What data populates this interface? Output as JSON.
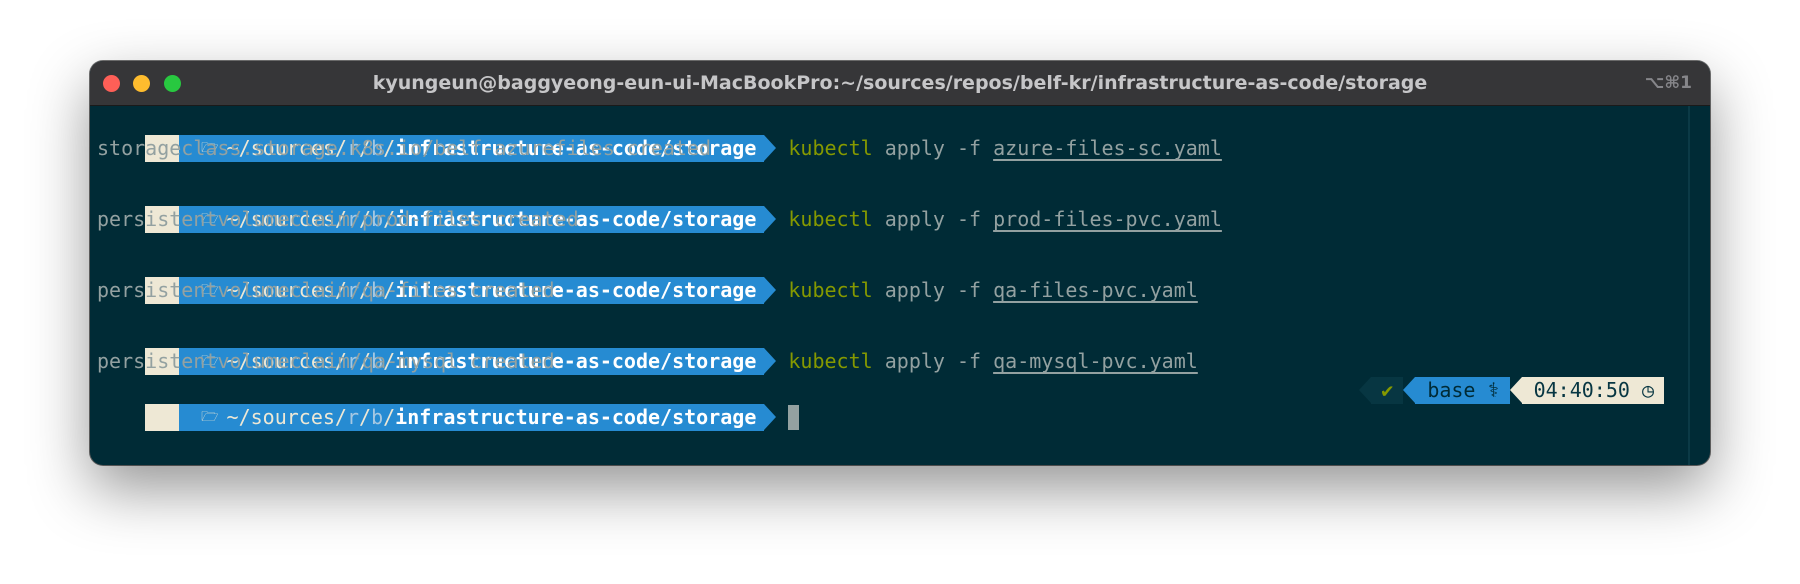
{
  "window": {
    "title": "kyungeun@baggyeong-eun-ui-MacBookPro:~/sources/repos/belf-kr/infrastructure-as-code/storage",
    "shortcut": "⌥⌘1"
  },
  "prompt": {
    "apple_glyph": "",
    "folder_icon": "folder-icon",
    "home": "~/",
    "sources": "sources/",
    "r": "r",
    "slash1": "/",
    "b": "b",
    "slash2": "/",
    "path_bold": "infrastructure-as-code/storage"
  },
  "entries": [
    {
      "command": "kubectl",
      "args": "apply -f",
      "file": "azure-files-sc.yaml",
      "output": "storageclass.storage.k8s.io/belf-azurefiles created"
    },
    {
      "command": "kubectl",
      "args": "apply -f",
      "file": "prod-files-pvc.yaml",
      "output": "persistentvolumeclaim/prod-files created"
    },
    {
      "command": "kubectl",
      "args": "apply -f",
      "file": "qa-files-pvc.yaml",
      "output": "persistentvolumeclaim/qa-files created"
    },
    {
      "command": "kubectl",
      "args": "apply -f",
      "file": "qa-mysql-pvc.yaml",
      "output": "persistentvolumeclaim/qa-mysql created"
    }
  ],
  "right_prompt": {
    "status": "✔",
    "env": "base",
    "env_icon": "python-icon",
    "time": "04:40:50",
    "clock_icon": "clock-icon"
  },
  "colors": {
    "terminal_bg": "#002b36",
    "prompt_blue": "#268bd2",
    "prompt_light": "#eee8d5",
    "command_green": "#859900",
    "text_gray": "#93a1a1"
  }
}
